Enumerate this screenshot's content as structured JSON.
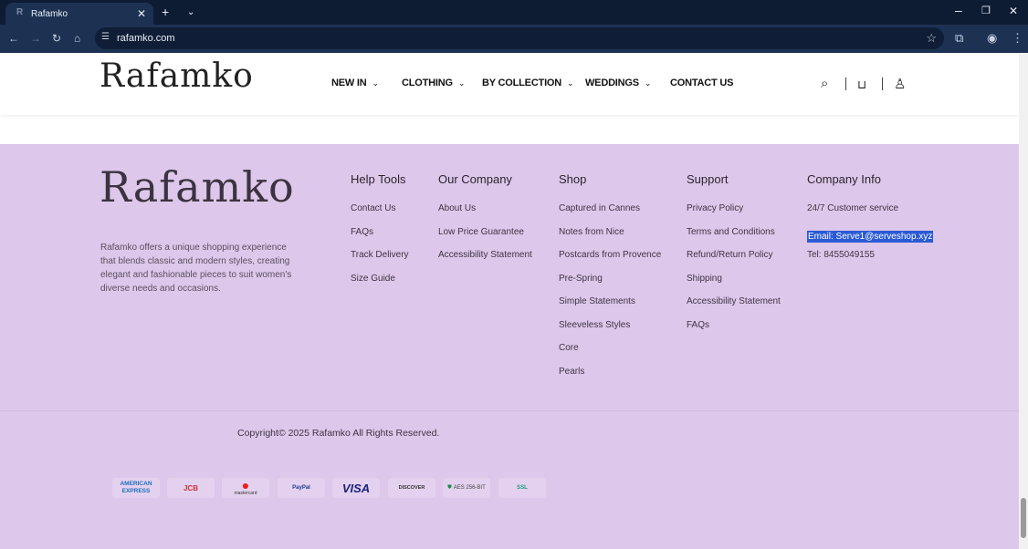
{
  "browser": {
    "tab_title": "Rafamko",
    "url": "rafamko.com"
  },
  "header": {
    "logo": "Rafamko",
    "nav": [
      {
        "label": "NEW IN"
      },
      {
        "label": "CLOTHING"
      },
      {
        "label": "BY COLLECTION"
      },
      {
        "label": "WEDDINGS"
      },
      {
        "label": "CONTACT US"
      }
    ]
  },
  "footer": {
    "logo": "Rafamko",
    "description": "Rafamko offers a unique shopping experience that blends classic and modern styles, creating elegant and fashionable pieces to suit women's diverse needs and occasions.",
    "columns": [
      {
        "title": "Help Tools",
        "links": [
          "Contact Us",
          "FAQs",
          "Track Delivery",
          "Size Guide"
        ]
      },
      {
        "title": "Our Company",
        "links": [
          "About Us",
          "Low Price Guarantee",
          "Accessibility Statement"
        ]
      },
      {
        "title": "Shop",
        "links": [
          "Captured in Cannes",
          "Notes from Nice",
          "Postcards from Provence",
          "Pre-Spring",
          "Simple Statements",
          "Sleeveless Styles",
          "Core",
          "Pearls"
        ]
      },
      {
        "title": "Support",
        "links": [
          "Privacy Policy",
          "Terms and Conditions",
          "Refund/Return Policy",
          "Shipping",
          "Accessibility Statement",
          "FAQs"
        ]
      },
      {
        "title": "Company Info",
        "links": [
          "24/7 Customer service",
          "Email: Serve1@serveshop.xyz",
          "Tel: 8455049155"
        ]
      }
    ],
    "copyright": "Copyright© 2025 Rafamko All Rights Reserved.",
    "payments": [
      "AMERICAN EXPRESS",
      "JCB",
      "mastercard",
      "PayPal",
      "VISA",
      "DISCOVER",
      "AES 256-BIT",
      "SSL"
    ]
  }
}
